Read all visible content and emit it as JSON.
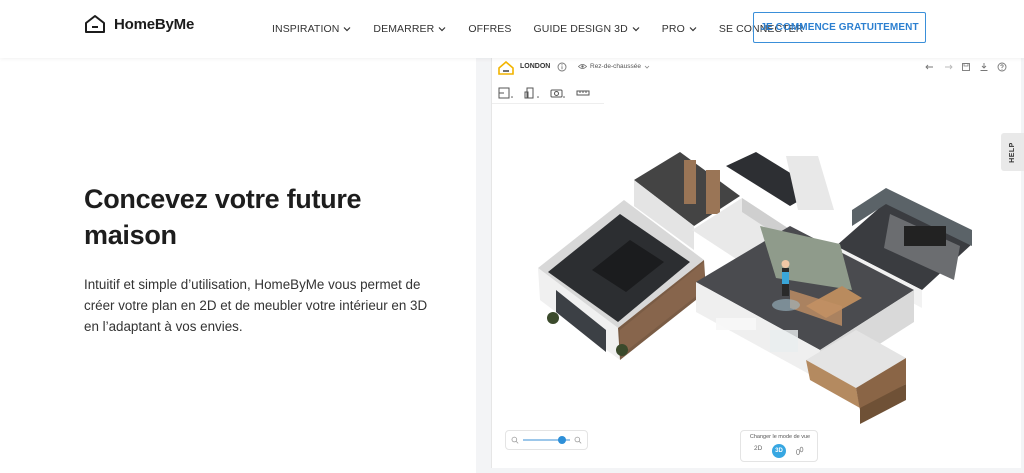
{
  "header": {
    "logo_text": "HomeByMe",
    "nav": [
      {
        "label": "INSPIRATION",
        "dropdown": true
      },
      {
        "label": "DEMARRER",
        "dropdown": true
      },
      {
        "label": "OFFRES",
        "dropdown": false
      },
      {
        "label": "GUIDE DESIGN 3D",
        "dropdown": true
      },
      {
        "label": "PRO",
        "dropdown": true
      },
      {
        "label": "SE CONNECTER",
        "dropdown": false
      }
    ],
    "cta_label": "JE COMMENCE GRATUITEMENT"
  },
  "hero": {
    "title": "Concevez votre future maison",
    "description": "Intuitif et simple d’utilisation, HomeByMe vous permet de créer votre plan en 2D et de meubler votre intérieur en 3D en l’adaptant à vos envies."
  },
  "app_preview": {
    "project_name": "LONDON",
    "level": "Rez-de-chaussée",
    "help_label": "HELP",
    "view_mode_label": "Changer le mode de vue",
    "view_modes": [
      "2D",
      "3D"
    ],
    "active_view_mode": "3D"
  },
  "colors": {
    "accent": "#2b7fd0",
    "view_active": "#37a7e2"
  }
}
